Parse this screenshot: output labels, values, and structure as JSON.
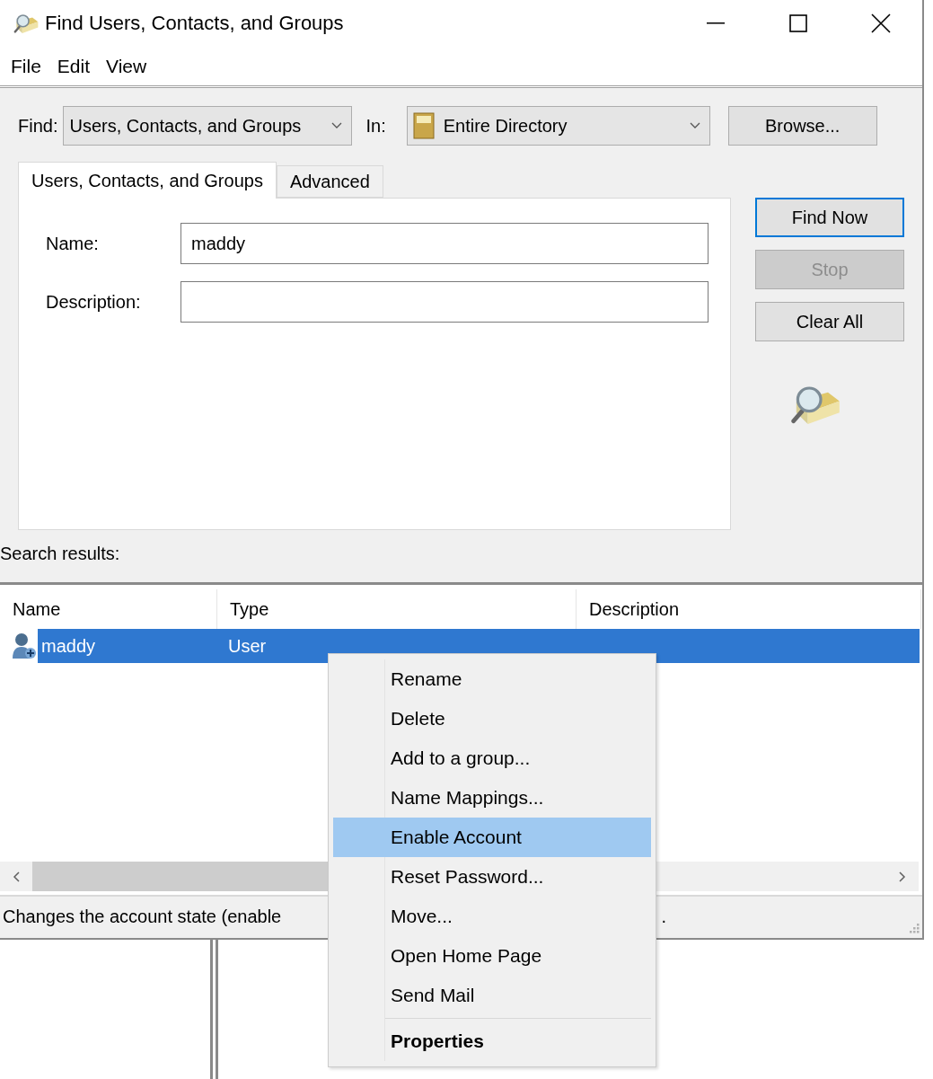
{
  "window": {
    "title": "Find Users, Contacts, and Groups"
  },
  "menu_bar": [
    "File",
    "Edit",
    "View"
  ],
  "find": {
    "label": "Find:",
    "value": "Users, Contacts, and Groups"
  },
  "in": {
    "label": "In:",
    "value": "Entire Directory"
  },
  "browse_button": "Browse...",
  "tabs": [
    {
      "label": "Users, Contacts, and Groups",
      "selected": true
    },
    {
      "label": "Advanced",
      "selected": false
    }
  ],
  "fields": [
    {
      "label": "Name:",
      "value": "maddy"
    },
    {
      "label": "Description:"
    }
  ],
  "action_buttons": [
    {
      "label": "Find Now",
      "default": true,
      "disabled": false
    },
    {
      "label": "Stop",
      "default": false,
      "disabled": true
    },
    {
      "label": "Clear All",
      "default": false,
      "disabled": false
    }
  ],
  "search_results": {
    "label": "Search results:",
    "columns": [
      "Name",
      "Type",
      "Description"
    ],
    "rows": [
      {
        "name": "maddy",
        "type": "User",
        "selected": true
      }
    ]
  },
  "status_bar": {
    "text": "Changes the account state (enable",
    "tail": "."
  },
  "context_menu": {
    "items": [
      {
        "kind": "item",
        "label": "Rename",
        "highlighted": false,
        "default": false
      },
      {
        "kind": "item",
        "label": "Delete",
        "highlighted": false,
        "default": false
      },
      {
        "kind": "item",
        "label": "Add to a group...",
        "highlighted": false,
        "default": false
      },
      {
        "kind": "item",
        "label": "Name Mappings...",
        "highlighted": false,
        "default": false
      },
      {
        "kind": "item",
        "label": "Enable Account",
        "highlighted": true,
        "default": false
      },
      {
        "kind": "item",
        "label": "Reset Password...",
        "highlighted": false,
        "default": false
      },
      {
        "kind": "item",
        "label": "Move...",
        "highlighted": false,
        "default": false
      },
      {
        "kind": "item",
        "label": "Open Home Page",
        "highlighted": false,
        "default": false
      },
      {
        "kind": "item",
        "label": "Send Mail",
        "highlighted": false,
        "default": false
      },
      {
        "kind": "separator"
      },
      {
        "kind": "item",
        "label": "Properties",
        "highlighted": false,
        "default": true
      }
    ]
  }
}
